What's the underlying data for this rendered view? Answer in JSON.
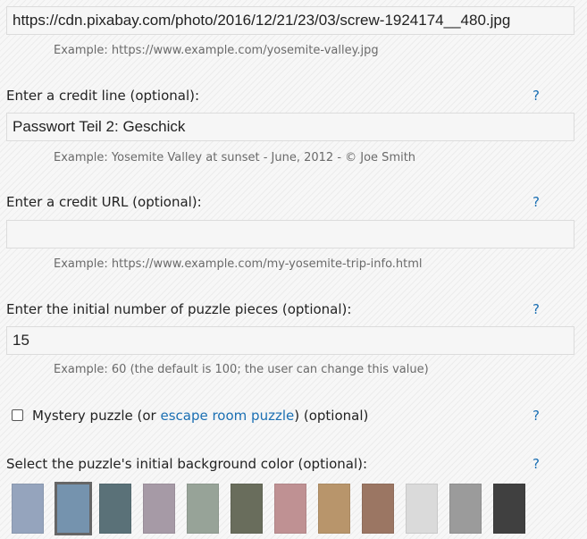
{
  "image_url": {
    "value": "https://cdn.pixabay.com/photo/2016/12/21/23/03/screw-1924174__480.jpg",
    "example": "Example: https://www.example.com/yosemite-valley.jpg"
  },
  "credit_line": {
    "label": "Enter a credit line (optional):",
    "help": "?",
    "value": "Passwort Teil 2: Geschick",
    "example": "Example: Yosemite Valley at sunset - June, 2012 - © Joe Smith"
  },
  "credit_url": {
    "label": "Enter a credit URL (optional):",
    "help": "?",
    "value": "",
    "example": "Example: https://www.example.com/my-yosemite-trip-info.html"
  },
  "pieces": {
    "label": "Enter the initial number of puzzle pieces (optional):",
    "help": "?",
    "value": "15",
    "example": "Example: 60 (the default is 100; the user can change this value)"
  },
  "mystery": {
    "checked": false,
    "label_before": "Mystery puzzle (or ",
    "link_text": "escape room puzzle",
    "label_after": ") (optional)",
    "help": "?"
  },
  "background": {
    "label": "Select the puzzle's initial background color (optional):",
    "help": "?",
    "selected_index": 1,
    "colors": [
      "#95a4bd",
      "#7593ae",
      "#5a7178",
      "#a69aa6",
      "#97a398",
      "#696d5c",
      "#bf9193",
      "#b8956b",
      "#9b7663",
      "#dadada",
      "#9b9b9b",
      "#404040"
    ]
  }
}
